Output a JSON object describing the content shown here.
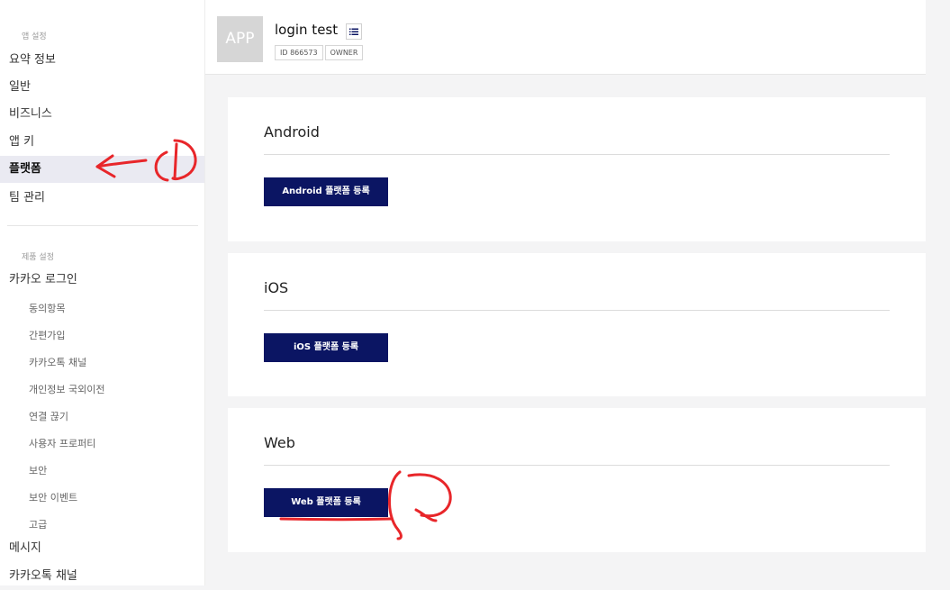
{
  "sidebar": {
    "app_settings_title": "앱 설정",
    "app_items": [
      "요약 정보",
      "일반",
      "비즈니스",
      "앱 키",
      "플랫폼",
      "팀 관리"
    ],
    "product_settings_title": "제품 설정",
    "kakao_login": "카카오 로그인",
    "login_sub_items": [
      "동의항목",
      "간편가입",
      "카카오톡 채널",
      "개인정보 국외이전",
      "연결 끊기",
      "사용자 프로퍼티",
      "보안",
      "보안 이벤트",
      "고급"
    ],
    "bottom_items": [
      "메시지",
      "카카오톡 채널"
    ]
  },
  "header": {
    "app_icon_text": "APP",
    "app_name": "login test",
    "id_tag": "ID 866573",
    "role_tag": "OWNER"
  },
  "platforms": [
    {
      "title": "Android",
      "button": "Android 플랫폼 등록"
    },
    {
      "title": "iOS",
      "button": "iOS 플랫폼 등록"
    },
    {
      "title": "Web",
      "button": "Web 플랫폼 등록"
    }
  ],
  "annotations": {
    "arrow_color": "#e8262a",
    "marks": [
      "1",
      "2"
    ]
  },
  "colors": {
    "primary_button": "#0b1563",
    "active_nav_bg": "#eaeaf2"
  }
}
